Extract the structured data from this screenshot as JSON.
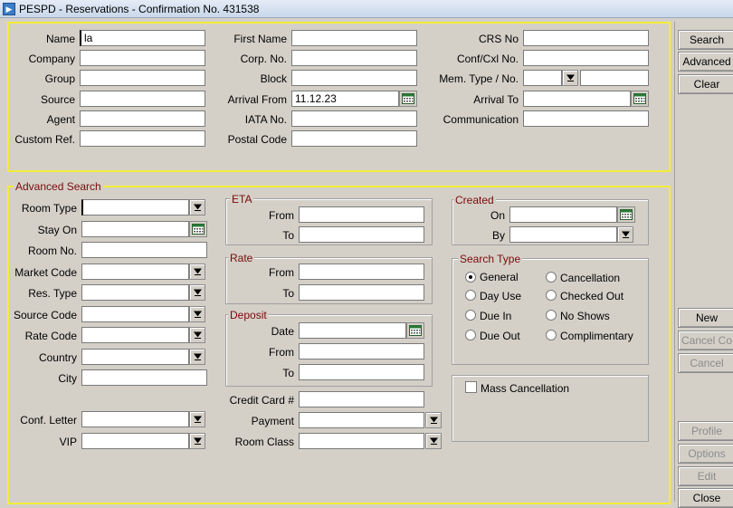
{
  "window": {
    "title": "PESPD - Reservations - Confirmation No. 431538",
    "icon": "app-icon"
  },
  "search": {
    "name_label": "Name",
    "name_value": "la",
    "company_label": "Company",
    "company_value": "",
    "group_label": "Group",
    "group_value": "",
    "source_label": "Source",
    "source_value": "",
    "agent_label": "Agent",
    "agent_value": "",
    "custom_ref_label": "Custom Ref.",
    "custom_ref_value": "",
    "first_name_label": "First Name",
    "first_name_value": "",
    "corp_no_label": "Corp. No.",
    "corp_no_value": "",
    "block_label": "Block",
    "block_value": "",
    "arrival_from_label": "Arrival From",
    "arrival_from_value": "11.12.23",
    "iata_label": "IATA No.",
    "iata_value": "",
    "postal_code_label": "Postal Code",
    "postal_code_value": "",
    "crs_no_label": "CRS No",
    "crs_no_value": "",
    "conf_cxl_label": "Conf/Cxl No.",
    "conf_cxl_value": "",
    "mem_type_label": "Mem. Type / No.",
    "mem_type_value": "",
    "mem_no_value": "",
    "arrival_to_label": "Arrival To",
    "arrival_to_value": "",
    "communication_label": "Communication",
    "communication_value": ""
  },
  "advanced": {
    "title": "Advanced Search",
    "room_type_label": "Room Type",
    "room_type_value": "",
    "stay_on_label": "Stay On",
    "stay_on_value": "",
    "room_no_label": "Room No.",
    "room_no_value": "",
    "market_code_label": "Market Code",
    "market_code_value": "",
    "res_type_label": "Res. Type",
    "res_type_value": "",
    "source_code_label": "Source Code",
    "source_code_value": "",
    "rate_code_label": "Rate Code",
    "rate_code_value": "",
    "country_label": "Country",
    "country_value": "",
    "city_label": "City",
    "city_value": "",
    "conf_letter_label": "Conf. Letter",
    "conf_letter_value": "",
    "vip_label": "VIP",
    "vip_value": "",
    "eta": {
      "title": "ETA",
      "from_label": "From",
      "to_label": "To",
      "from_value": "",
      "to_value": ""
    },
    "rate": {
      "title": "Rate",
      "from_label": "From",
      "to_label": "To",
      "from_value": "",
      "to_value": ""
    },
    "deposit": {
      "title": "Deposit",
      "date_label": "Date",
      "from_label": "From",
      "to_label": "To",
      "date_value": "",
      "from_value": "",
      "to_value": ""
    },
    "credit_card_label": "Credit Card #",
    "credit_card_value": "",
    "payment_label": "Payment",
    "payment_value": "",
    "room_class_label": "Room Class",
    "room_class_value": "",
    "created": {
      "title": "Created",
      "on_label": "On",
      "by_label": "By",
      "on_value": "",
      "by_value": ""
    },
    "search_type": {
      "title": "Search Type",
      "selected": "General",
      "options": [
        "General",
        "Cancellation",
        "Day Use",
        "Checked Out",
        "Due In",
        "No Shows",
        "Due Out",
        "Complimentary"
      ]
    },
    "mass_cancellation_label": "Mass Cancellation"
  },
  "buttons": {
    "search": "Search",
    "advanced": "Advanced",
    "clear": "Clear",
    "new": "New",
    "cancel_co": "Cancel Co",
    "cancel": "Cancel",
    "profile": "Profile",
    "options": "Options",
    "edit": "Edit",
    "close": "Close"
  }
}
